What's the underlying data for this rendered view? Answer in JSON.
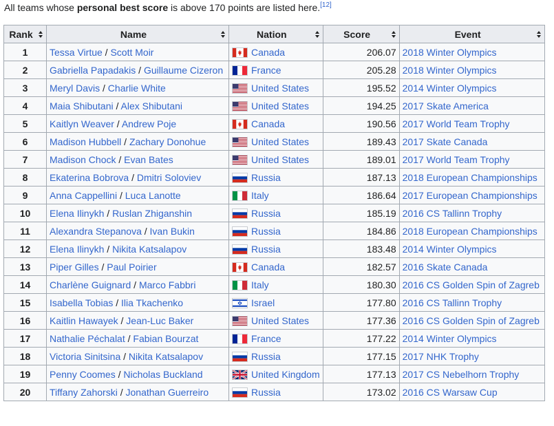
{
  "intro": {
    "prefix": "All teams whose ",
    "bold": "personal best score",
    "suffix": " is above 170 points are listed here.",
    "ref": "[12]"
  },
  "headers": {
    "rank": "Rank",
    "name": "Name",
    "nation": "Nation",
    "score": "Score",
    "event": "Event"
  },
  "rows": [
    {
      "rank": "1",
      "skater1": "Tessa Virtue",
      "skater2": "Scott Moir",
      "flag": "canada",
      "nation": "Canada",
      "score": "206.07",
      "event": "2018 Winter Olympics"
    },
    {
      "rank": "2",
      "skater1": "Gabriella Papadakis",
      "skater2": "Guillaume Cizeron",
      "flag": "france",
      "nation": "France",
      "score": "205.28",
      "event": "2018 Winter Olympics"
    },
    {
      "rank": "3",
      "skater1": "Meryl Davis",
      "skater2": "Charlie White",
      "flag": "usa",
      "nation": "United States",
      "score": "195.52",
      "event": "2014 Winter Olympics"
    },
    {
      "rank": "4",
      "skater1": "Maia Shibutani",
      "skater2": "Alex Shibutani",
      "flag": "usa",
      "nation": "United States",
      "score": "194.25",
      "event": "2017 Skate America"
    },
    {
      "rank": "5",
      "skater1": "Kaitlyn Weaver",
      "skater2": "Andrew Poje",
      "flag": "canada",
      "nation": "Canada",
      "score": "190.56",
      "event": "2017 World Team Trophy"
    },
    {
      "rank": "6",
      "skater1": "Madison Hubbell",
      "skater2": "Zachary Donohue",
      "flag": "usa",
      "nation": "United States",
      "score": "189.43",
      "event": "2017 Skate Canada"
    },
    {
      "rank": "7",
      "skater1": "Madison Chock",
      "skater2": "Evan Bates",
      "flag": "usa",
      "nation": "United States",
      "score": "189.01",
      "event": "2017 World Team Trophy"
    },
    {
      "rank": "8",
      "skater1": "Ekaterina Bobrova",
      "skater2": "Dmitri Soloviev",
      "flag": "russia",
      "nation": "Russia",
      "score": "187.13",
      "event": "2018 European Championships"
    },
    {
      "rank": "9",
      "skater1": "Anna Cappellini",
      "skater2": "Luca Lanotte",
      "flag": "italy",
      "nation": "Italy",
      "score": "186.64",
      "event": "2017 European Championships"
    },
    {
      "rank": "10",
      "skater1": "Elena Ilinykh",
      "skater2": "Ruslan Zhiganshin",
      "flag": "russia",
      "nation": "Russia",
      "score": "185.19",
      "event": "2016 CS Tallinn Trophy"
    },
    {
      "rank": "11",
      "skater1": "Alexandra Stepanova",
      "skater2": "Ivan Bukin",
      "flag": "russia",
      "nation": "Russia",
      "score": "184.86",
      "event": "2018 European Championships"
    },
    {
      "rank": "12",
      "skater1": "Elena Ilinykh",
      "skater2": "Nikita Katsalapov",
      "flag": "russia",
      "nation": "Russia",
      "score": "183.48",
      "event": "2014 Winter Olympics"
    },
    {
      "rank": "13",
      "skater1": "Piper Gilles",
      "skater2": "Paul Poirier",
      "flag": "canada",
      "nation": "Canada",
      "score": "182.57",
      "event": "2016 Skate Canada"
    },
    {
      "rank": "14",
      "skater1": "Charlène Guignard",
      "skater2": "Marco Fabbri",
      "flag": "italy",
      "nation": "Italy",
      "score": "180.30",
      "event": "2016 CS Golden Spin of Zagreb"
    },
    {
      "rank": "15",
      "skater1": "Isabella Tobias",
      "skater2": "Ilia Tkachenko",
      "flag": "israel",
      "nation": "Israel",
      "score": "177.80",
      "event": "2016 CS Tallinn Trophy"
    },
    {
      "rank": "16",
      "skater1": "Kaitlin Hawayek",
      "skater2": "Jean-Luc Baker",
      "flag": "usa",
      "nation": "United States",
      "score": "177.36",
      "event": "2016 CS Golden Spin of Zagreb"
    },
    {
      "rank": "17",
      "skater1": "Nathalie Péchalat",
      "skater2": "Fabian Bourzat",
      "flag": "france",
      "nation": "France",
      "score": "177.22",
      "event": "2014 Winter Olympics"
    },
    {
      "rank": "18",
      "skater1": "Victoria Sinitsina",
      "skater2": "Nikita Katsalapov",
      "flag": "russia",
      "nation": "Russia",
      "score": "177.15",
      "event": "2017 NHK Trophy"
    },
    {
      "rank": "19",
      "skater1": "Penny Coomes",
      "skater2": "Nicholas Buckland",
      "flag": "uk",
      "nation": "United Kingdom",
      "score": "177.13",
      "event": "2017 CS Nebelhorn Trophy"
    },
    {
      "rank": "20",
      "skater1": "Tiffany Zahorski",
      "skater2": "Jonathan Guerreiro",
      "flag": "russia",
      "nation": "Russia",
      "score": "173.02",
      "event": "2016 CS Warsaw Cup"
    }
  ],
  "colors": {
    "link": "#3366cc",
    "header_bg": "#eaecf0",
    "table_bg": "#f8f9fa",
    "border": "#a2a9b1"
  }
}
